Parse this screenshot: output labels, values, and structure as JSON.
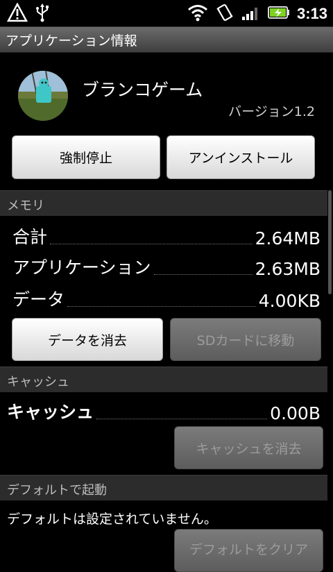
{
  "status_bar": {
    "time": "3:13",
    "icons": [
      "warning-icon",
      "usb-icon",
      "wifi-icon",
      "vibrate-icon",
      "signal-icon",
      "battery-charging-icon"
    ]
  },
  "title": "アプリケーション情報",
  "app": {
    "name": "ブランコゲーム",
    "version": "バージョン1.2",
    "icon": "swing-game-app-icon"
  },
  "top_buttons": {
    "force_stop": "強制停止",
    "uninstall": "アンインストール"
  },
  "memory": {
    "header": "メモリ",
    "rows": [
      {
        "label": "合計",
        "value": "2.64MB"
      },
      {
        "label": "アプリケーション",
        "value": "2.63MB"
      },
      {
        "label": "データ",
        "value": "4.00KB"
      }
    ],
    "clear_data": "データを消去",
    "move_to_sd": "SDカードに移動"
  },
  "cache": {
    "header": "キャッシュ",
    "label": "キャッシュ",
    "value": "0.00B",
    "clear_cache": "キャッシュを消去"
  },
  "defaults": {
    "header": "デフォルトで起動",
    "message": "デフォルトは設定されていません。",
    "clear_defaults": "デフォルトをクリア"
  },
  "colors": {
    "background": "#000000",
    "section_bg": "#2c2c2c",
    "battery_green": "#7ed321"
  }
}
